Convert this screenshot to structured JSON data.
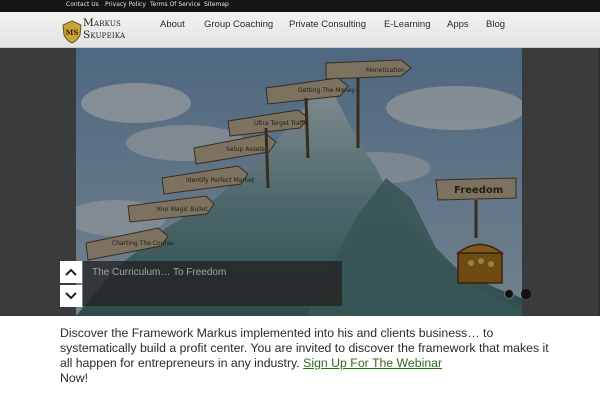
{
  "topbar": {
    "links": [
      "Contact Us",
      "Privacy Policy",
      "Terms Of Service",
      "Sitemap"
    ]
  },
  "logo": {
    "line1": "Markus",
    "line2": "Skupeika",
    "monogram": "MS"
  },
  "nav": {
    "items": [
      "About",
      "Group Coaching",
      "Private Consulting",
      "E-Learning",
      "Apps",
      "Blog"
    ]
  },
  "hero": {
    "signs": [
      "Monetization",
      "Getting The Money",
      "Ultra Target Traffic",
      "Setup Assets",
      "Identify Perfect Market",
      "Your Magic Bullet",
      "Charting The Course"
    ],
    "freedom_sign": "Freedom",
    "caption": "The Curriculum… To Freedom",
    "up_icon": "chevron-up-icon",
    "down_icon": "chevron-down-icon"
  },
  "intro": {
    "text": "Discover the Framework Markus implemented into his and clients business… to systematically build a profit center. You are invited to discover the framework that makes it all happen for entrepreneurs in any industry.",
    "link": "Sign Up For The Webinar",
    "after": "Now!"
  },
  "colors": {
    "link": "#2e6a17",
    "topbar": "#151515",
    "hero_bg": "#2e2f30"
  }
}
